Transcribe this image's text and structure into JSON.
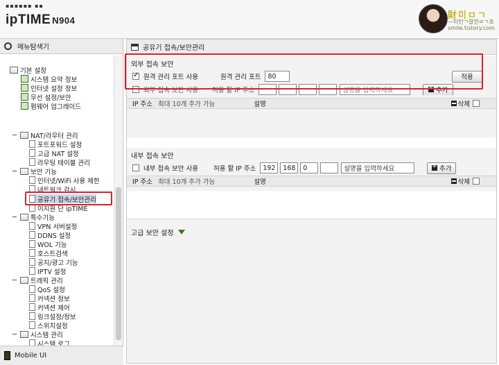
{
  "header": {
    "logo_dots": "▪▪▪▪▪▪ ▪▪",
    "brand": "ipTIME",
    "model": "N904",
    "watermark_top": "財미ㅁㄱ",
    "watermark_mid": "—미턴ㄱ잘잔ㄹㄱ조",
    "watermark_bottom": "smile.tistory.com"
  },
  "sidebar": {
    "title": "메뉴탐색기",
    "groups": [
      {
        "label": "기본 설정",
        "items": [
          "시스템 요약 정보",
          "인터넷 설정 정보",
          "무선 설정/보안",
          "펌웨어 업그레이드"
        ]
      },
      {
        "label": "NAT/라우터 관리",
        "items": [
          "포트포워드 설정",
          "고급 NAT 설정",
          "라우팅 테이블 관리"
        ]
      },
      {
        "label": "보안 기능",
        "items": [
          "인터넷/WiFi 사용 제한",
          "네트워크 감시",
          "공유기 접속/보안관리",
          "이지원 단 ipTIME"
        ]
      },
      {
        "label": "특수기능",
        "items": [
          "VPN 서버설정",
          "DDNS 설정",
          "WOL 기능",
          "호스트검색",
          "공지/광고 기능",
          "IPTV 설정"
        ]
      },
      {
        "label": "트래픽 관리",
        "items": [
          "QoS 설정",
          "커넥션 정보",
          "커넥션 제어",
          "링크설정/정보",
          "스위치설정"
        ]
      },
      {
        "label": "시스템 관리",
        "items": [
          "시스템 로그"
        ]
      }
    ],
    "selected": "공유기 접속/보안관리",
    "mobile_ui": "Mobile UI"
  },
  "main": {
    "title": "공유기 접속/보안관리",
    "external": {
      "heading": "외부 접속 보안",
      "remote_label": "원격 관리 포트 사용",
      "remote_checked": true,
      "port_label": "원격 관리 포트",
      "port_value": "80",
      "apply_label": "적용",
      "allow_label_partial": "외부 접속 보안 사용",
      "allow_ip_label": "허용 할 IP 주소",
      "desc_placeholder": "설명을 입력하세요",
      "add_label": "추가",
      "col_ip": "IP 주소",
      "col_max": "최대 10개 추가 가능",
      "col_desc": "설명",
      "col_delete": "삭제"
    },
    "internal": {
      "heading": "내부 접속 보안",
      "use_label": "내부 접속 보안 사용",
      "allow_ip_label": "허용 할 IP 주소",
      "ip1": "192",
      "ip2": "168",
      "ip3": "0",
      "ip4": "",
      "desc_placeholder": "설명을 입력하세요",
      "add_label": "추가",
      "col_ip": "IP 주소",
      "col_max": "최대 10개 추가 가능",
      "col_desc": "설명",
      "col_delete": "삭제"
    },
    "advanced": {
      "heading": "고급 보안 설정"
    }
  },
  "colors": {
    "highlight_box": "#d8202a",
    "section_bg": "#f3f3f3",
    "advanced_arrow": "#3d7a1d"
  }
}
